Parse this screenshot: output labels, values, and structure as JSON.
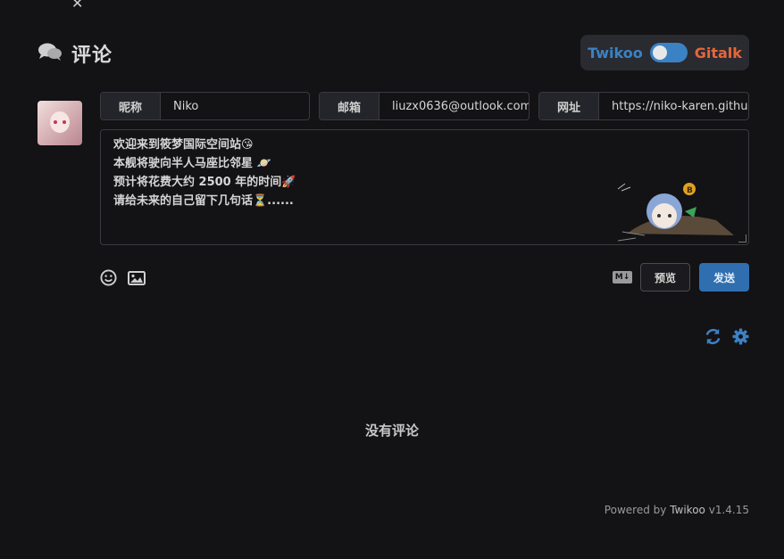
{
  "header": {
    "title": "评论",
    "icon": "comments-icon"
  },
  "switch": {
    "left_label": "Twikoo",
    "right_label": "Gitalk",
    "left_color": "#3b82c4",
    "right_color": "#e8663a"
  },
  "form": {
    "nick_label": "昵称",
    "nick_value": "Niko",
    "mail_label": "邮箱",
    "mail_value": "liuzx0636@outlook.com",
    "site_label": "网址",
    "site_value": "https://niko-karen.github.io",
    "comment_lines": [
      "欢迎来到筱梦国际空间站😘",
      "本舰将驶向半人马座比邻星 🪐",
      "预计将花费大约 2500 年的时间🚀",
      "请给未来的自己留下几句话⏳......"
    ]
  },
  "toolbar": {
    "emoji_icon": "smile-icon",
    "image_icon": "image-icon",
    "markdown_badge": "M↓",
    "preview_label": "预览",
    "send_label": "发送",
    "accent": "#2f6fb0"
  },
  "actions": {
    "refresh_icon": "refresh-icon",
    "settings_icon": "gear-icon"
  },
  "empty_text": "没有评论",
  "footer": {
    "powered_by": "Powered by",
    "product": "Twikoo",
    "version": "v1.4.15"
  }
}
